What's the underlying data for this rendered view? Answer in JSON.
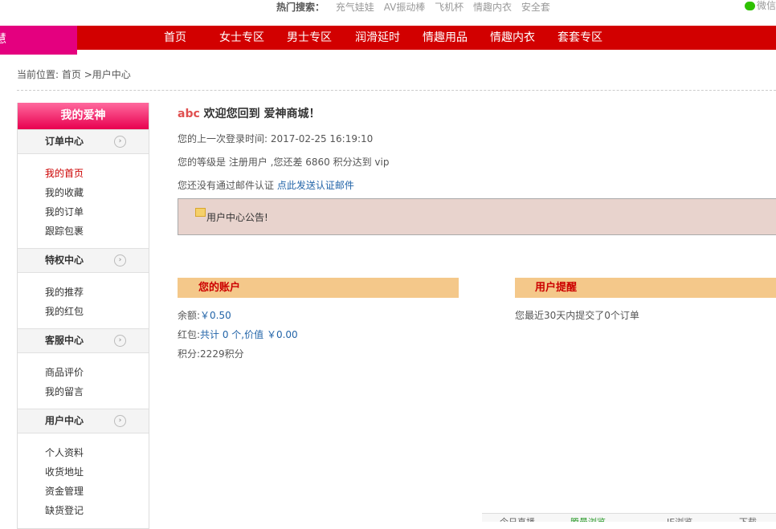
{
  "top": {
    "hot_label": "热门搜索：",
    "hot_items": [
      "充气娃娃",
      "AV振动棒",
      "飞机杯",
      "情趣内衣",
      "安全套"
    ],
    "wechat": "微信"
  },
  "nav": {
    "logo_text": "慧",
    "items": [
      "首页",
      "女士专区",
      "男士专区",
      "润滑延时",
      "情趣用品",
      "情趣内衣",
      "套套专区"
    ]
  },
  "breadcrumb": {
    "prefix": "当前位置: ",
    "home": "首页",
    "sep": ">",
    "current": "用户中心"
  },
  "sidebar": {
    "title": "我的爱神",
    "sections": [
      {
        "title": "订单中心",
        "items": [
          "我的首页",
          "我的收藏",
          "我的订单",
          "跟踪包裹"
        ]
      },
      {
        "title": "特权中心",
        "items": [
          "我的推荐",
          "我的红包"
        ]
      },
      {
        "title": "客服中心",
        "items": [
          "商品评价",
          "我的留言"
        ]
      },
      {
        "title": "用户中心",
        "items": [
          "个人资料",
          "收货地址",
          "资金管理",
          "缺货登记"
        ]
      }
    ]
  },
  "main": {
    "username": "abc",
    "welcome": " 欢迎您回到 爱神商城！",
    "last_login": "您的上一次登录时间: 2017-02-25 16:19:10",
    "level": "您的等级是 注册用户 ,您还差 6860 积分达到 vip",
    "email_verify_text": "您还没有通过邮件认证 ",
    "email_verify_link": "点此发送认证邮件",
    "notice": "用户中心公告!",
    "account_title": "您的账户",
    "balance_label": "余额:",
    "balance_value": "￥0.50",
    "bonus_label": "红包:",
    "bonus_value": "共计 0 个,价值 ￥0.00",
    "points": "积分:2229积分",
    "reminder_title": "用户提醒",
    "reminder_text": "您最近30天内提交了0个订单"
  },
  "bottom": {
    "items": [
      "今日直播",
      "腾曼浏览",
      "IE浏览",
      "下载"
    ]
  },
  "colors": {
    "nav_red": "#d20000",
    "accent_pink": "#e4007f",
    "box_header": "#f4c88a",
    "notice_bg": "#e8d3cd",
    "link_blue": "#2264a8"
  }
}
